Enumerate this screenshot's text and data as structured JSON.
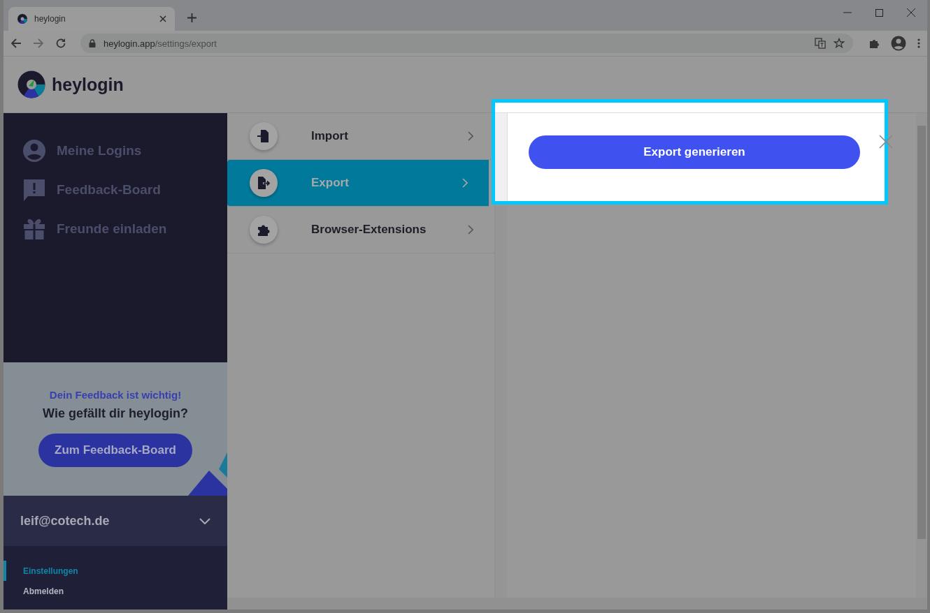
{
  "browser": {
    "tab_title": "heylogin",
    "url_host": "heylogin.app",
    "url_path": "/settings/export"
  },
  "app": {
    "logo_text": "heylogin"
  },
  "sidebar": {
    "items": [
      {
        "label": "Meine Logins"
      },
      {
        "label": "Feedback-Board"
      },
      {
        "label": "Freunde einladen"
      }
    ]
  },
  "feedback_card": {
    "kicker": "Dein Feedback ist wichtig!",
    "title": "Wie gefällt dir heylogin?",
    "button": "Zum Feedback-Board"
  },
  "account": {
    "email": "leif@cotech.de"
  },
  "account_menu": [
    {
      "label": "Einstellungen",
      "selected": true
    },
    {
      "label": "Abmelden",
      "selected": false
    }
  ],
  "settings_menu": [
    {
      "label": "Import",
      "selected": false
    },
    {
      "label": "Export",
      "selected": true
    },
    {
      "label": "Browser-Extensions",
      "selected": false
    }
  ],
  "export_panel": {
    "button": "Export generieren"
  }
}
